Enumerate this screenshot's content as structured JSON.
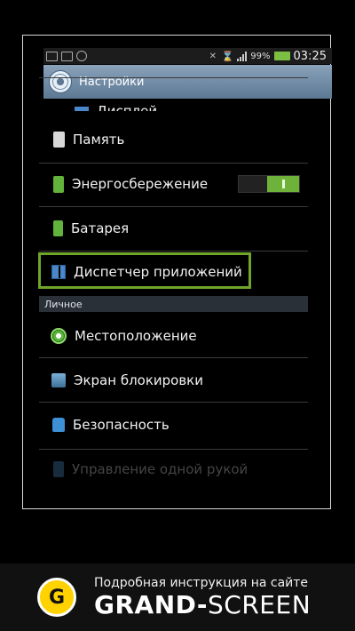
{
  "statusbar": {
    "battery_percent": "99%",
    "time": "03:25"
  },
  "titlebar": {
    "title": "Настройки"
  },
  "menu": {
    "items": [
      {
        "label": "Дисплей"
      },
      {
        "label": "Память"
      },
      {
        "label": "Энергосбережение"
      },
      {
        "label": "Батарея"
      },
      {
        "label": "Диспетчер приложений"
      }
    ],
    "section_header": "Личное",
    "personal_items": [
      {
        "label": "Местоположение"
      },
      {
        "label": "Экран блокировки"
      },
      {
        "label": "Безопасность"
      },
      {
        "label": "Управление одной рукой"
      }
    ]
  },
  "power_saving_toggle": {
    "state": "on"
  },
  "banner": {
    "logo_letter": "G",
    "subtitle": "Подробная инструкция на сайте",
    "brand_part1": "GRAND-",
    "brand_part2": "SCREEN"
  },
  "colors": {
    "highlight": "#6fa62a",
    "toggle_on": "#6fb23a",
    "titlebar": "#7890aa",
    "logo": "#ffd200"
  }
}
